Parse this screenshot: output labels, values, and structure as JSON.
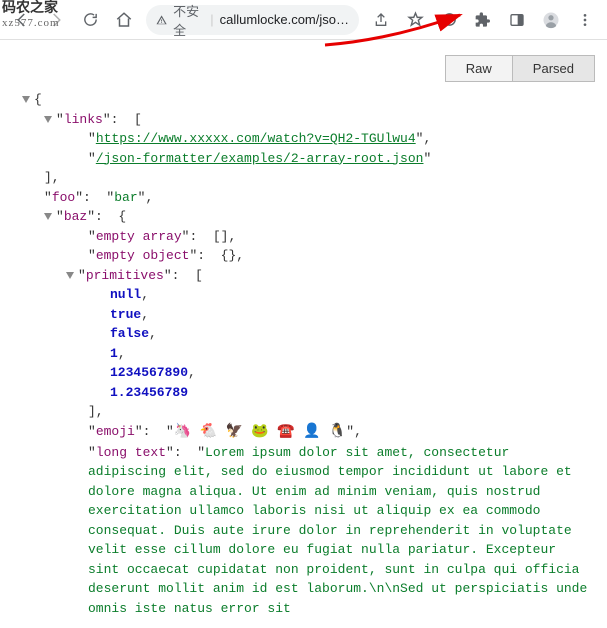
{
  "watermark": {
    "line1": "码农之家",
    "line2": "xz577.com"
  },
  "address": {
    "insecure": "不安全",
    "url_display": "callumlocke.com/jso…"
  },
  "tabs": {
    "raw": "Raw",
    "parsed": "Parsed"
  },
  "json": {
    "keys": {
      "links": "links",
      "foo": "foo",
      "baz": "baz",
      "empty_array": "empty array",
      "empty_object": "empty object",
      "primitives": "primitives",
      "emoji": "emoji",
      "long_text": "long text"
    },
    "links": [
      "https://www.xxxxx.com/watch?v=QH2-TGUlwu4",
      "/json-formatter/examples/2-array-root.json"
    ],
    "foo_value": "bar",
    "primitives": {
      "p0": "null",
      "p1": "true",
      "p2": "false",
      "p3": "1",
      "p4": "1234567890",
      "p5": "1.23456789"
    },
    "emoji_value": "🦄 🐔 🦅 🐸 ☎️    👤 🐧",
    "long_text_value": "Lorem ipsum dolor sit amet, consectetur adipiscing elit, sed do eiusmod tempor incididunt ut labore et dolore magna aliqua. Ut enim ad minim veniam, quis nostrud exercitation ullamco laboris nisi ut aliquip ex ea commodo consequat. Duis aute irure dolor in reprehenderit in voluptate velit esse cillum dolore eu fugiat nulla pariatur. Excepteur sint occaecat cupidatat non proident, sunt in culpa qui officia deserunt mollit anim id est laborum.\\n\\nSed ut perspiciatis unde omnis iste natus error sit"
  }
}
